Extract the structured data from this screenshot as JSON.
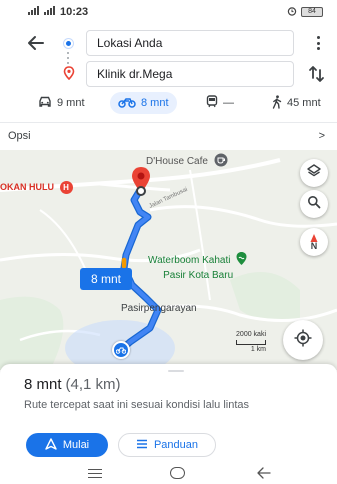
{
  "status_bar": {
    "time": "10:23",
    "signal_1": "䷀",
    "signal_2": "䷀",
    "battery": "84"
  },
  "route": {
    "origin": "Lokasi Anda",
    "destination": "Klinik dr.Mega"
  },
  "modes": [
    {
      "icon": "car-icon",
      "label": "9 mnt",
      "active": false
    },
    {
      "icon": "motorcycle-icon",
      "label": "8 mnt",
      "active": true
    },
    {
      "icon": "transit-icon",
      "label": "—",
      "active": false
    },
    {
      "icon": "walk-icon",
      "label": "45 mnt",
      "active": false
    }
  ],
  "options": {
    "label": "Opsi",
    "chevron": ">"
  },
  "map": {
    "places": {
      "cafe": "D'House Cafe",
      "hulu": "OKAN HULU",
      "waterboom_1": "Waterboom Kahati",
      "waterboom_2": "Pasir Kota Baru",
      "pasir": "Pasirpengarayan"
    },
    "road_label": "Jalan Tambusai",
    "route_time": "8 mnt",
    "scale_top": "2000 kaki",
    "scale_bottom": "1 km",
    "compass": "N"
  },
  "sheet": {
    "time": "8 mnt",
    "distance": "(4,1 km)",
    "description": "Rute tercepat saat ini sesuai kondisi lalu lintas",
    "start_label": "Mulai",
    "steps_label": "Panduan"
  },
  "colors": {
    "accent": "#1a73e8",
    "route": "#4285f4",
    "destination": "#ea4335"
  }
}
